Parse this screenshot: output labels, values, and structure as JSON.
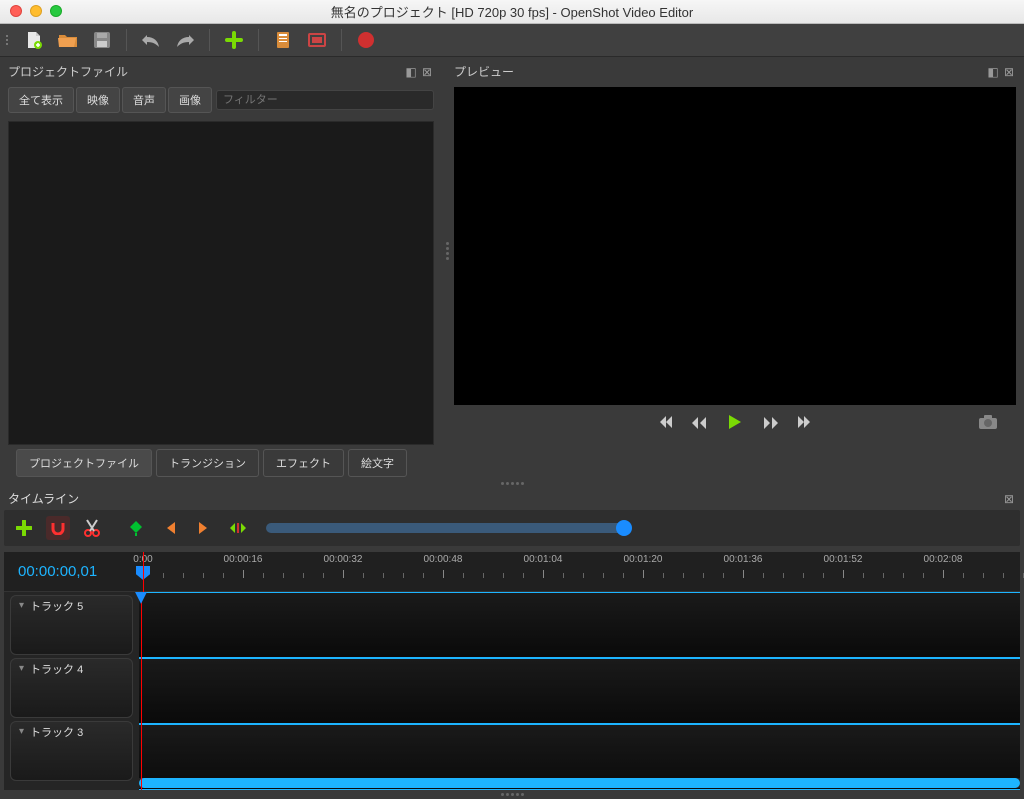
{
  "window": {
    "title": "無名のプロジェクト [HD 720p 30 fps] - OpenShot Video Editor"
  },
  "panels": {
    "project_files_title": "プロジェクトファイル",
    "preview_title": "プレビュー",
    "timeline_title": "タイムライン"
  },
  "filter_tabs": {
    "show_all": "全て表示",
    "video": "映像",
    "audio": "音声",
    "image": "画像",
    "filter_placeholder": "フィルター"
  },
  "bottom_tabs": {
    "project_files": "プロジェクトファイル",
    "transitions": "トランジション",
    "effects": "エフェクト",
    "emoji": "絵文字"
  },
  "timeline": {
    "timecode": "00:00:00,01",
    "ruler_labels": [
      "0:00",
      "00:00:16",
      "00:00:32",
      "00:00:48",
      "00:01:04",
      "00:01:20",
      "00:01:36",
      "00:01:52",
      "00:02:08"
    ],
    "tracks": [
      {
        "label": "トラック 5"
      },
      {
        "label": "トラック 4"
      },
      {
        "label": "トラック 3"
      }
    ]
  }
}
